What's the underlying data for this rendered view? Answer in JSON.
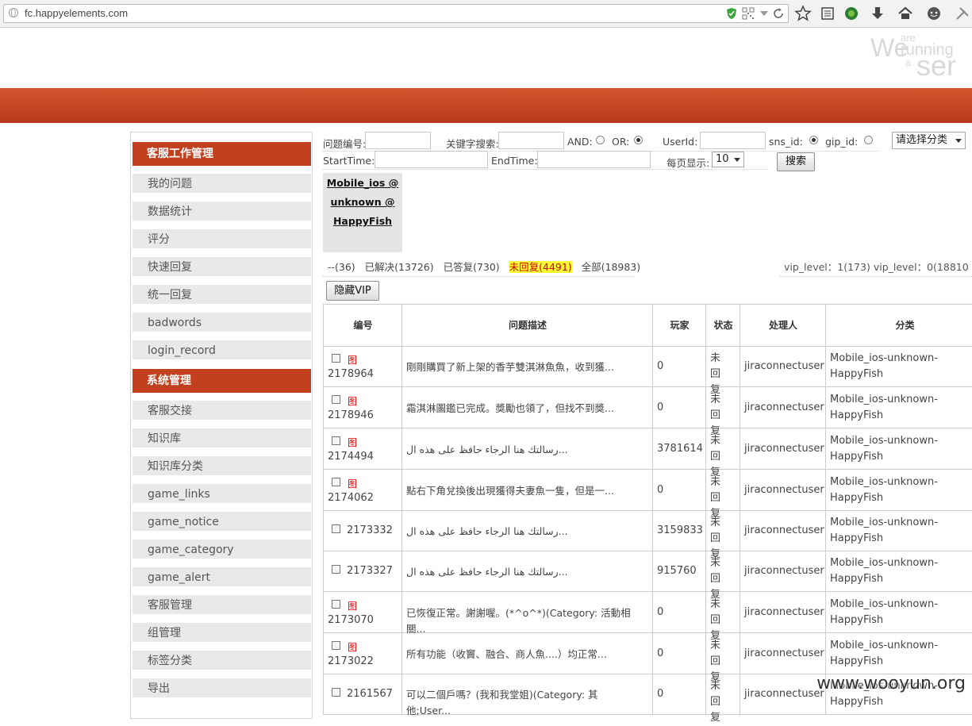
{
  "browser": {
    "url": "fc.happyelements.com"
  },
  "brand": {
    "we": "We",
    "are": "are",
    "running": "running",
    "a": "a",
    "ser": "ser"
  },
  "sidebar": {
    "section1": "客服工作管理",
    "items1": [
      "我的问题",
      "数据统计",
      "评分",
      "快速回复",
      "统一回复",
      "badwords",
      "login_record"
    ],
    "section2": "系统管理",
    "items2": [
      "客服交接",
      "知识库",
      "知识库分类",
      "game_links",
      "game_notice",
      "game_category",
      "game_alert",
      "客服管理",
      "组管理",
      "标签分类",
      "导出"
    ]
  },
  "search": {
    "issue_no_label": "问题编号:",
    "keyword_label": "关键字搜索:",
    "and_label": "AND:",
    "or_label": "OR:",
    "userid_label": "UserId:",
    "sns_label": "sns_id:",
    "gip_label": "gip_id:",
    "category_select": "请选择分类",
    "start_label": "StartTime:",
    "end_label": "EndTime:",
    "per_page_label": "每页显示:",
    "per_page_value": "10",
    "search_button": "搜索"
  },
  "category_box": {
    "line1": "Mobile_ios @",
    "line2": "unknown @",
    "line3": "HappyFish"
  },
  "status": {
    "dash": "--(36)",
    "resolved": "已解决(13726)",
    "answered": "已答复(730)",
    "unreplied": "未回复(4491)",
    "all": "全部(18983)",
    "vip": "vip_level：1(173)   vip_level：0(18810"
  },
  "hide_vip_button": "隐藏VIP",
  "table": {
    "headers": [
      "编号",
      "问题描述",
      "玩家",
      "状态",
      "处理人",
      "分类"
    ],
    "pic_label": "图",
    "rows": [
      {
        "id": "2178964",
        "desc": "剛剛購買了新上架的香芋雙淇淋魚魚，收到獲...",
        "player": "0",
        "state": "未回复",
        "handler": "jiraconnectuser",
        "cat1": "Mobile_ios-unknown-",
        "cat2": "HappyFish",
        "pic": true
      },
      {
        "id": "2178946",
        "desc": "霜淇淋圖鑑已完成。獎勵也領了，但找不到獎...",
        "player": "0",
        "state": "未回复",
        "handler": "jiraconnectuser",
        "cat1": "Mobile_ios-unknown-",
        "cat2": "HappyFish",
        "pic": true
      },
      {
        "id": "2174494",
        "desc": "رسالتك هنا الرجاء حافظ على هذه ال...",
        "player": "3781614",
        "state": "未回复",
        "handler": "jiraconnectuser",
        "cat1": "Mobile_ios-unknown-",
        "cat2": "HappyFish",
        "pic": true
      },
      {
        "id": "2174062",
        "desc": "點右下角兌換後出現獲得夫妻魚一隻，但是一...",
        "player": "0",
        "state": "未回复",
        "handler": "jiraconnectuser",
        "cat1": "Mobile_ios-unknown-",
        "cat2": "HappyFish",
        "pic": true
      },
      {
        "id": "2173332",
        "desc": "رسالتك هنا الرجاء حافظ على هذه ال...",
        "player": "3159833",
        "state": "未回复",
        "handler": "jiraconnectuser",
        "cat1": "Mobile_ios-unknown-",
        "cat2": "HappyFish",
        "pic": false
      },
      {
        "id": "2173327",
        "desc": "رسالتك هنا الرجاء حافظ على هذه ال...",
        "player": "915760",
        "state": "未回复",
        "handler": "jiraconnectuser",
        "cat1": "Mobile_ios-unknown-",
        "cat2": "HappyFish",
        "pic": false
      },
      {
        "id": "2173070",
        "desc": "已恢復正常。謝謝喔。(*^o^*)(Category: 活動相關...",
        "player": "0",
        "state": "未回复",
        "handler": "jiraconnectuser",
        "cat1": "Mobile_ios-unknown-",
        "cat2": "HappyFish",
        "pic": true
      },
      {
        "id": "2173022",
        "desc": "所有功能（收竇、融合、商人魚....）均正常...",
        "player": "0",
        "state": "未回复",
        "handler": "jiraconnectuser",
        "cat1": "Mobile_ios-unknown-",
        "cat2": "HappyFish",
        "pic": true
      },
      {
        "id": "2161567",
        "desc": "可以二個戶嗎？(我和我堂姐)(Category: 其他;User...",
        "player": "0",
        "state": "未回复",
        "handler": "jiraconnectuser",
        "cat1": "Mobile_ios-unknown-",
        "cat2": "HappyFish",
        "pic": false
      }
    ]
  },
  "watermark": "www.wooyun.org"
}
